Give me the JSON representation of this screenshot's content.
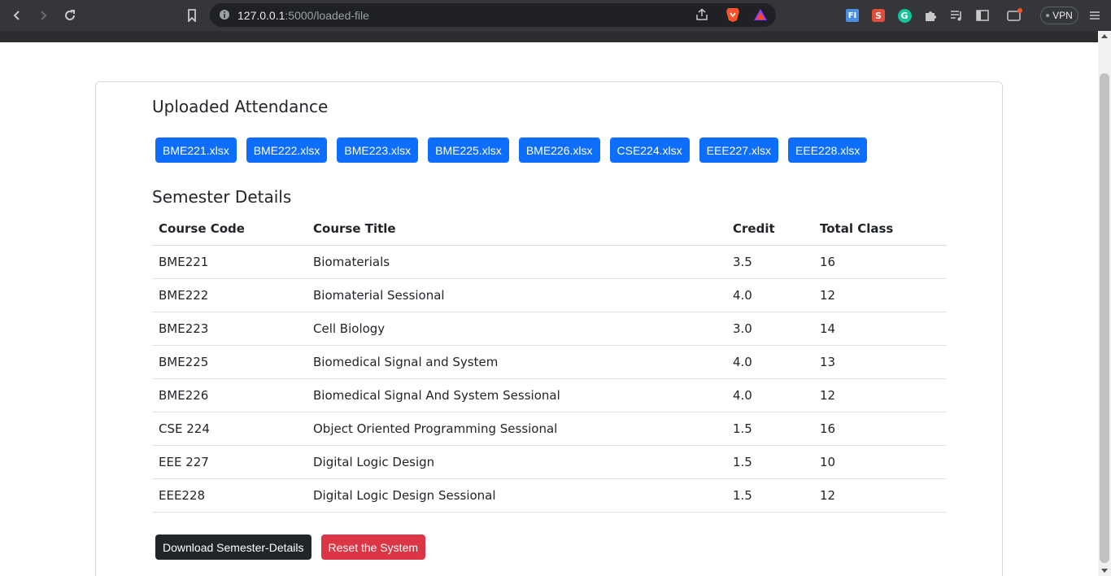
{
  "browser": {
    "url_host": "127.0.0.1",
    "url_rest": ":5000/loaded-file",
    "vpn_label": "VPN",
    "extensions": [
      "fi-extension-icon",
      "s-extension-icon",
      "grammarly-icon",
      "puzzle-extensions-icon",
      "media-queue-icon",
      "sidebar-icon",
      "wallet-icon"
    ]
  },
  "page": {
    "uploaded_title": "Uploaded Attendance",
    "files": [
      "BME221.xlsx",
      "BME222.xlsx",
      "BME223.xlsx",
      "BME225.xlsx",
      "BME226.xlsx",
      "CSE224.xlsx",
      "EEE227.xlsx",
      "EEE228.xlsx"
    ],
    "semester_title": "Semester Details",
    "table": {
      "headers": {
        "code": "Course Code",
        "title": "Course Title",
        "credit": "Credit",
        "total": "Total Class"
      },
      "rows": [
        {
          "code": "BME221",
          "title": "Biomaterials",
          "credit": "3.5",
          "total": "16"
        },
        {
          "code": "BME222",
          "title": "Biomaterial Sessional",
          "credit": "4.0",
          "total": "12"
        },
        {
          "code": "BME223",
          "title": "Cell Biology",
          "credit": "3.0",
          "total": "14"
        },
        {
          "code": "BME225",
          "title": "Biomedical Signal and System",
          "credit": "4.0",
          "total": "13"
        },
        {
          "code": "BME226",
          "title": "Biomedical Signal And System Sessional",
          "credit": "4.0",
          "total": "12"
        },
        {
          "code": "CSE 224",
          "title": "Object Oriented Programming Sessional",
          "credit": "1.5",
          "total": "16"
        },
        {
          "code": "EEE 227",
          "title": "Digital Logic Design",
          "credit": "1.5",
          "total": "10"
        },
        {
          "code": "EEE228",
          "title": "Digital Logic Design Sessional",
          "credit": "1.5",
          "total": "12"
        }
      ]
    },
    "download_label": "Download Semester-Details",
    "reset_label": "Reset the System"
  },
  "colors": {
    "primary": "#0d6efd",
    "dark": "#212529",
    "danger": "#dc3545"
  }
}
